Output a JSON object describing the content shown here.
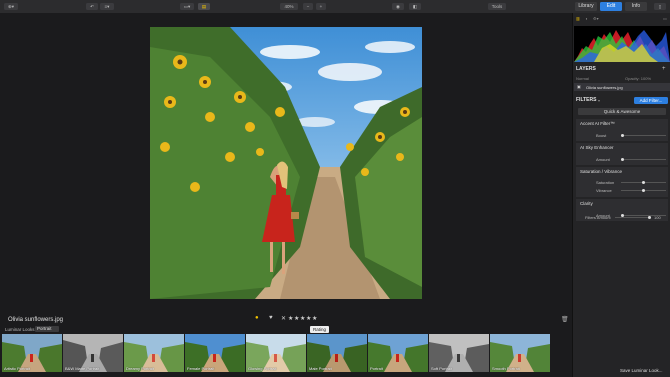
{
  "toolbar": {
    "zoom": "40%",
    "tools_label": "Tools",
    "tabs": {
      "library": "Library",
      "edit": "Edit",
      "info": "Info"
    }
  },
  "photo": {
    "filename": "Olivia sunflowers.jpg",
    "tooltip": "Rating"
  },
  "looks": {
    "label": "Luminar Looks",
    "selected": "Portrait",
    "items": [
      {
        "name": "Artistic Portrait"
      },
      {
        "name": "B&W Matte Portrait"
      },
      {
        "name": "Dreamy Portrait"
      },
      {
        "name": "Female Portrait"
      },
      {
        "name": "Glowing Portrait"
      },
      {
        "name": "Male Portrait"
      },
      {
        "name": "Portrait"
      },
      {
        "name": "Soft Portrait"
      },
      {
        "name": "Smooth Portrait"
      }
    ],
    "save_label": "Save Luminar Look..."
  },
  "side": {
    "layers_title": "LAYERS",
    "layer_mode": "Normal",
    "opacity": "Opacity: 100%",
    "layer_name": "Olivia sunflowers.jpg",
    "filters_title": "FILTERS",
    "add_filter": "Add Filter...",
    "preset": "Quick & Awesome",
    "filters": [
      {
        "name": "Accent AI Filter™",
        "sliders": [
          {
            "label": "Boost",
            "value": 0.0
          }
        ]
      },
      {
        "name": "AI Sky Enhancer",
        "sliders": [
          {
            "label": "Amount",
            "value": 0.0
          }
        ]
      },
      {
        "name": "Saturation / Vibrance",
        "sliders": [
          {
            "label": "Saturation",
            "value": 0.5
          },
          {
            "label": "Vibrance",
            "value": 0.5
          }
        ]
      },
      {
        "name": "Clarity",
        "sliders": [
          {
            "label": "Amount",
            "value": 0.0
          }
        ]
      }
    ],
    "filters_amount_label": "Filters Amount",
    "filters_amount_value": "100"
  },
  "colors": {
    "accent": "#2d7fe0",
    "rating_dot": "#f2c400"
  }
}
